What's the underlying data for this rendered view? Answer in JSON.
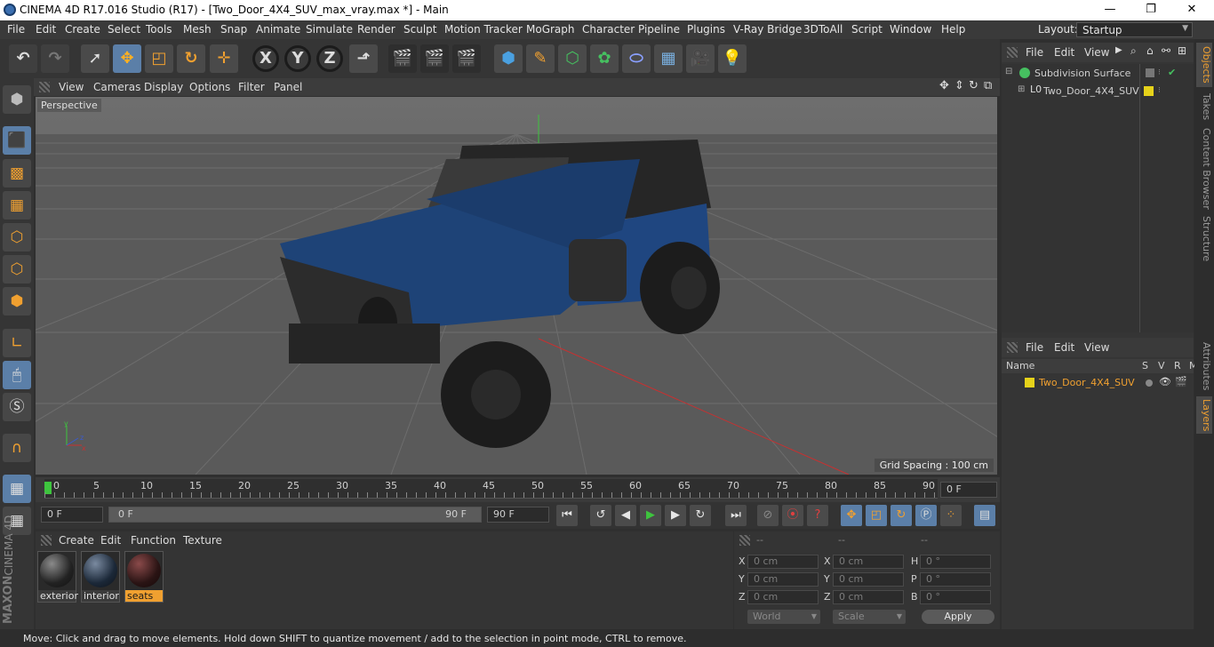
{
  "window": {
    "title": "CINEMA 4D R17.016 Studio (R17) - [Two_Door_4X4_SUV_max_vray.max *] - Main",
    "minimize": "—",
    "maximize": "❐",
    "close": "✕"
  },
  "menu": [
    "File",
    "Edit",
    "Create",
    "Select",
    "Tools",
    "Mesh",
    "Snap",
    "Animate",
    "Simulate",
    "Render",
    "Sculpt",
    "Motion Tracker",
    "MoGraph",
    "Character",
    "Pipeline",
    "Plugins",
    "V-Ray Bridge",
    "3DToAll",
    "Script",
    "Window",
    "Help"
  ],
  "layout": {
    "label": "Layout:",
    "value": "Startup"
  },
  "viewport": {
    "menu": [
      "View",
      "Cameras",
      "Display",
      "Options",
      "Filter",
      "Panel"
    ],
    "camera": "Perspective",
    "grid_spacing": "Grid Spacing : 100 cm"
  },
  "timeline": {
    "ticks": [
      "0",
      "5",
      "10",
      "15",
      "20",
      "25",
      "30",
      "35",
      "40",
      "45",
      "50",
      "55",
      "60",
      "65",
      "70",
      "75",
      "80",
      "85",
      "90"
    ],
    "current_frame": "0 F"
  },
  "transport": {
    "start": "0 F",
    "range_start": "0 F",
    "range_end": "90 F",
    "end": "90 F"
  },
  "materials": {
    "menu": [
      "Create",
      "Edit",
      "Function",
      "Texture"
    ],
    "items": [
      {
        "name": "exterior",
        "selected": false
      },
      {
        "name": "interior",
        "selected": false
      },
      {
        "name": "seats",
        "selected": true
      }
    ]
  },
  "coords": {
    "headers": [
      "--",
      "--",
      "--"
    ],
    "rows": [
      {
        "a": "X",
        "av": "0 cm",
        "b": "X",
        "bv": "0 cm",
        "c": "H",
        "cv": "0 °"
      },
      {
        "a": "Y",
        "av": "0 cm",
        "b": "Y",
        "bv": "0 cm",
        "c": "P",
        "cv": "0 °"
      },
      {
        "a": "Z",
        "av": "0 cm",
        "b": "Z",
        "bv": "0 cm",
        "c": "B",
        "cv": "0 °"
      }
    ],
    "mode1": "World",
    "mode2": "Scale",
    "apply": "Apply"
  },
  "objects": {
    "menu": [
      "File",
      "Edit",
      "View"
    ],
    "items": [
      "Subdivision Surface",
      "Two_Door_4X4_SUV"
    ]
  },
  "layers": {
    "menu": [
      "File",
      "Edit",
      "View"
    ],
    "columns": [
      "Name",
      "S",
      "V",
      "R",
      "M"
    ],
    "items": [
      "Two_Door_4X4_SUV"
    ]
  },
  "sidetabs_top": [
    "Objects",
    "Takes",
    "Content Browser",
    "Structure"
  ],
  "sidetabs_bottom": [
    "Attributes",
    "Layers"
  ],
  "brand": {
    "line1": "MAXON",
    "line2": "CINEMA 4D"
  },
  "status": "Move: Click and drag to move elements. Hold down SHIFT to quantize movement / add to the selection in point mode, CTRL to remove.",
  "colors": {
    "accent": "#5b7fa8",
    "layer_yellow": "#e6d21a",
    "selected_label": "#f0a030"
  }
}
